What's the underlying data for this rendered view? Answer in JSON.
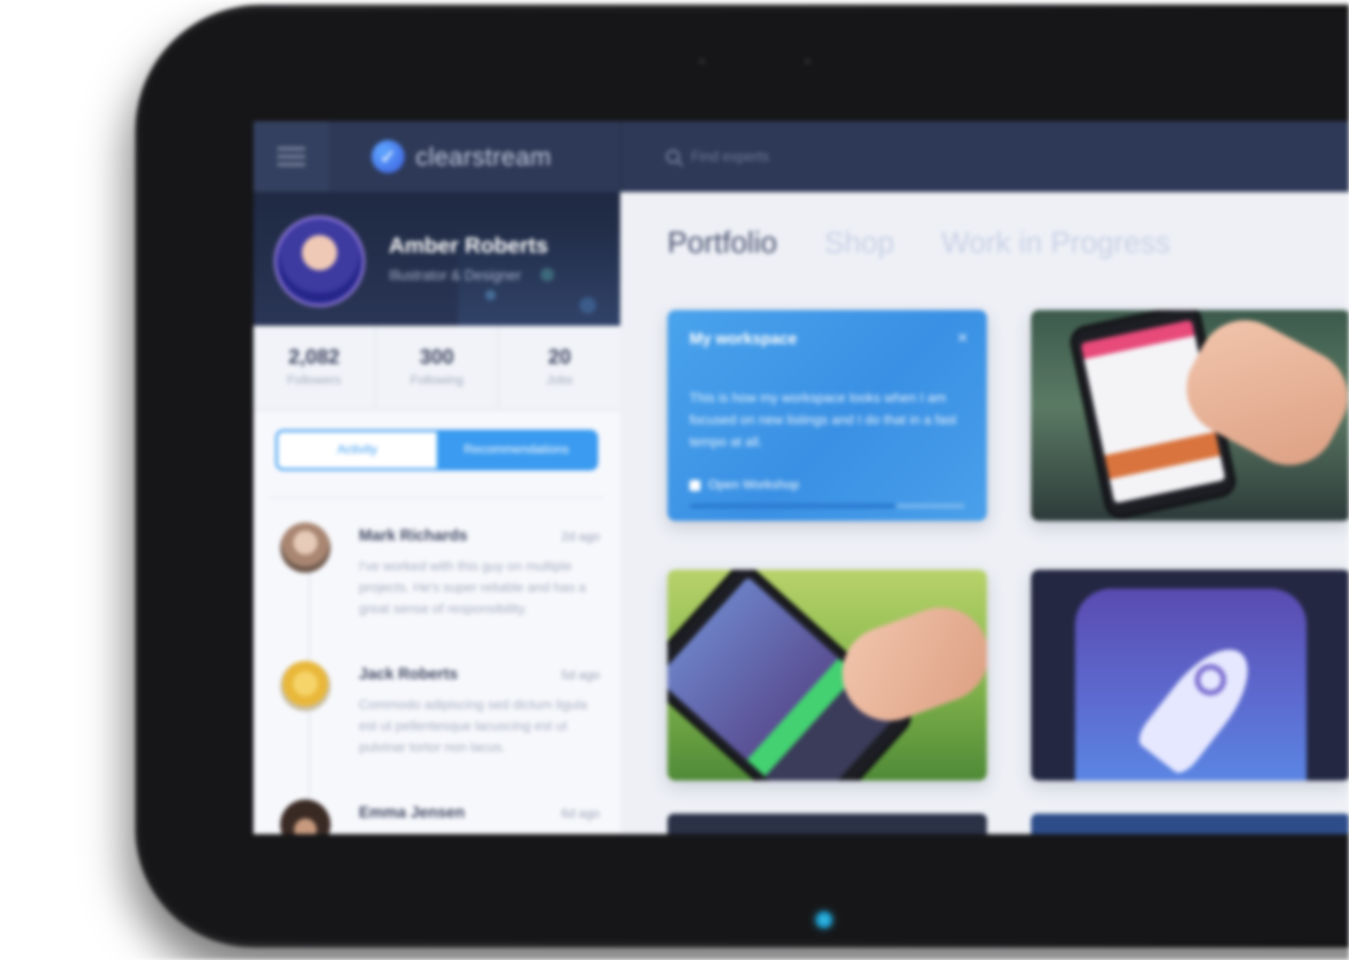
{
  "topbar": {
    "brand_name": "clearstream",
    "search_placeholder": "Find experts"
  },
  "profile": {
    "name": "Amber Roberts",
    "role": "Illustrator & Designer"
  },
  "stats": [
    {
      "value": "2,082",
      "label": "Followers"
    },
    {
      "value": "300",
      "label": "Following"
    },
    {
      "value": "20",
      "label": "Jobs"
    }
  ],
  "toggle": {
    "left_label": "Activity",
    "right_label": "Recommendations"
  },
  "feed": [
    {
      "name": "Mark Richards",
      "time": "2d ago",
      "text": "I've worked with this guy on multiple projects. He's super reliable and has a great sense of responsibility."
    },
    {
      "name": "Jack Roberts",
      "time": "5d ago",
      "text": "Commodo adipiscing sed dictum ligula est ut pellentesque lacuscing est ut pulvinar tortor non lacus."
    },
    {
      "name": "Emma Jensen",
      "time": "6d ago",
      "text": ""
    }
  ],
  "main": {
    "tabs": [
      "Portfolio",
      "Shop",
      "Work in Progress"
    ],
    "workspace_card": {
      "title": "My workspace",
      "close": "×",
      "body": "This is how my workspace looks when I am focused on new listings and I do that in a fast tempo at all.",
      "link_label": "Open Workshop",
      "progress": 0.75
    }
  },
  "colors": {
    "topbar": "#2e3957",
    "accent": "#3a9bf0",
    "home_led": "#38c8f0"
  }
}
